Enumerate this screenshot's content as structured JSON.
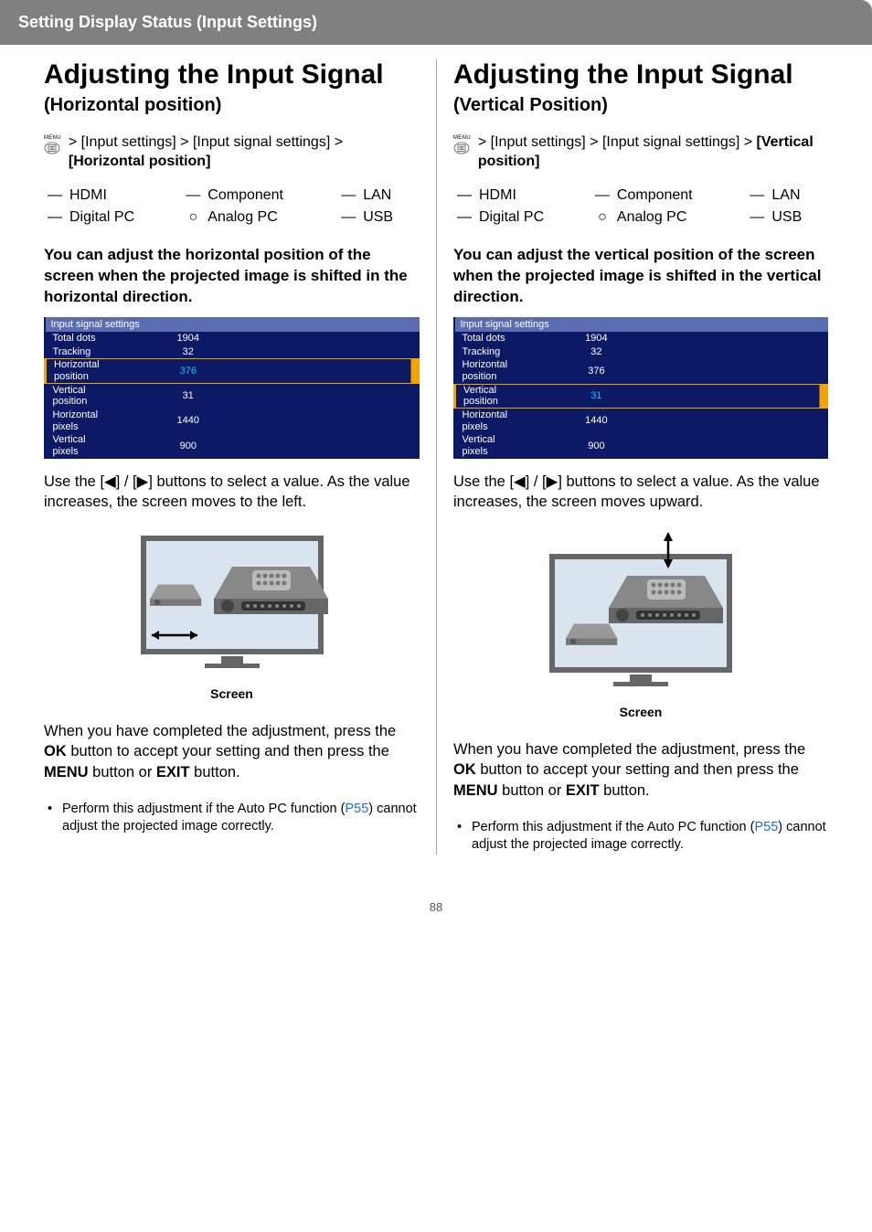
{
  "header": "Setting Display Status (Input Settings)",
  "left": {
    "title": "Adjusting the Input Signal",
    "subtitle": "(Horizontal position)",
    "menu_label": "MENU",
    "path_prefix": " > [Input settings] > [Input signal settings] > ",
    "path_bold": "[Horizontal position]",
    "compat": [
      {
        "sym": "—",
        "label": "HDMI"
      },
      {
        "sym": "—",
        "label": "Component"
      },
      {
        "sym": "—",
        "label": "LAN"
      },
      {
        "sym": "—",
        "label": "Digital PC"
      },
      {
        "sym": "○",
        "label": "Analog PC"
      },
      {
        "sym": "—",
        "label": "USB"
      }
    ],
    "desc": "You can adjust the horizontal position of the screen when the projected image is shifted in the horizontal direction.",
    "settings_header": "Input signal settings",
    "settings": [
      {
        "name": "Total dots",
        "value": "1904"
      },
      {
        "name": "Tracking",
        "value": "32"
      },
      {
        "name": "Horizontal position",
        "value": "376",
        "hl": true
      },
      {
        "name": "Vertical position",
        "value": "31"
      },
      {
        "name": "Horizontal pixels",
        "value": "1440"
      },
      {
        "name": "Vertical pixels",
        "value": "900"
      }
    ],
    "usage": "Use the [◀] / [▶] buttons to select a value. As the value increases, the screen moves to the left.",
    "screen_label": "Screen",
    "complete_pre": "When you have completed the adjustment, press the ",
    "ok": "OK",
    "complete_mid": " button to accept your setting and then press the ",
    "menu_btn": "MENU",
    "complete_mid2": " button or ",
    "exit_btn": "EXIT",
    "complete_end": " button.",
    "note_pre": "Perform this adjustment if the Auto PC function (",
    "note_link": "P55",
    "note_post": ") cannot adjust the projected image correctly."
  },
  "right": {
    "title": "Adjusting the Input Signal",
    "subtitle": "(Vertical Position)",
    "menu_label": "MENU",
    "path_prefix": " > [Input settings] > [Input signal settings] > ",
    "path_bold": "[Vertical position]",
    "compat": [
      {
        "sym": "—",
        "label": "HDMI"
      },
      {
        "sym": "—",
        "label": "Component"
      },
      {
        "sym": "—",
        "label": "LAN"
      },
      {
        "sym": "—",
        "label": "Digital PC"
      },
      {
        "sym": "○",
        "label": "Analog PC"
      },
      {
        "sym": "—",
        "label": "USB"
      }
    ],
    "desc": "You can adjust the vertical position of the screen when the projected image is shifted in the vertical direction.",
    "settings_header": "Input signal settings",
    "settings": [
      {
        "name": "Total dots",
        "value": "1904"
      },
      {
        "name": "Tracking",
        "value": "32"
      },
      {
        "name": "Horizontal position",
        "value": "376"
      },
      {
        "name": "Vertical position",
        "value": "31",
        "hl": true
      },
      {
        "name": "Horizontal pixels",
        "value": "1440"
      },
      {
        "name": "Vertical pixels",
        "value": "900"
      }
    ],
    "usage": "Use the [◀] / [▶] buttons to select a value. As the value increases, the screen moves upward.",
    "screen_label": "Screen",
    "complete_pre": "When you have completed the adjustment, press the ",
    "ok": "OK",
    "complete_mid": " button to accept your setting and then press the ",
    "menu_btn": "MENU",
    "complete_mid2": " button or ",
    "exit_btn": "EXIT",
    "complete_end": " button.",
    "note_pre": "Perform this adjustment if the Auto PC function (",
    "note_link": "P55",
    "note_post": ") cannot adjust the projected image correctly."
  },
  "page_number": "88"
}
